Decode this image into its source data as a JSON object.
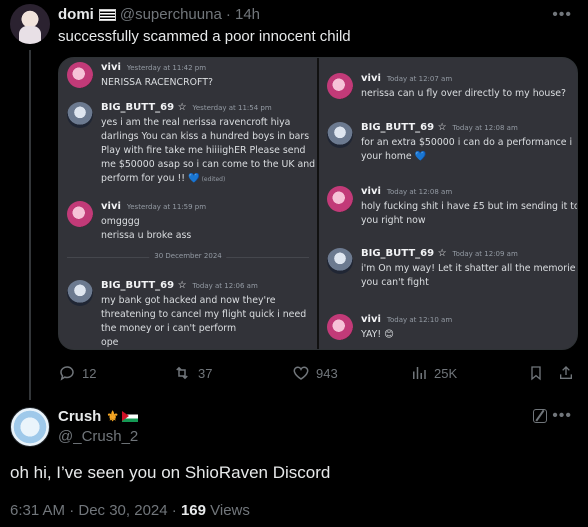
{
  "tweet": {
    "author_name": "domi",
    "handle": "@superchuuna",
    "time": "· 14h",
    "text": "successfully scammed a poor innocent child",
    "screenshot": {
      "left_messages": [
        {
          "author": "vivi",
          "time": "Yesterday at 11:42 pm",
          "lines": [
            "NERISSA RACENCROFT?"
          ],
          "avatar": "vivi"
        },
        {
          "author": "BIG_BUTT_69 ☆",
          "time": "Yesterday at 11:54 pm",
          "lines": [
            "yes i am the real nerissa ravencroft hiya",
            "darlings You can kiss a hundred boys in bars",
            "Play with fire take me hiiiighER Please send",
            "me $50000 asap so i can come to the UK and",
            "perform for you !! 💙"
          ],
          "edited": "(edited)",
          "avatar": "big"
        },
        {
          "author": "vivi",
          "time": "Yesterday at 11:59 pm",
          "lines": [
            "omgggg",
            "nerissa u broke ass"
          ],
          "avatar": "vivi"
        },
        {
          "author": "BIG_BUTT_69 ☆",
          "time": "Today at 12:06 am",
          "lines": [
            "my bank got hacked and now they're",
            "threatening to cancel my flight quick i need",
            "the money or i can't perform",
            "ope"
          ],
          "avatar": "big"
        }
      ],
      "date_separator": "30 December 2024",
      "right_messages": [
        {
          "author": "vivi",
          "time": "Today at 12:07 am",
          "lines": [
            "nerissa can u fly over directly to my house?"
          ],
          "avatar": "vivi"
        },
        {
          "author": "BIG_BUTT_69 ☆",
          "time": "Today at 12:08 am",
          "lines": [
            "for an extra $50000 i can do a performance i",
            "your home 💙"
          ],
          "avatar": "big"
        },
        {
          "author": "vivi",
          "time": "Today at 12:08 am",
          "lines": [
            "holy fucking shit i have £5 but im sending it to",
            "you right now"
          ],
          "avatar": "vivi"
        },
        {
          "author": "BIG_BUTT_69 ☆",
          "time": "Today at 12:09 am",
          "lines": [
            "i'm On my way! Let it shatter all the memorie",
            "you can't fight"
          ],
          "avatar": "big"
        },
        {
          "author": "vivi",
          "time": "Today at 12:10 am",
          "lines": [
            "YAY! 😊"
          ],
          "avatar": "vivi"
        }
      ]
    },
    "actions": {
      "replies": "12",
      "reposts": "37",
      "likes": "943",
      "views": "25K"
    }
  },
  "reply": {
    "author_name": "Crush",
    "handle": "@_Crush_2",
    "text": "oh hi, I’ve seen you on ShioRaven Discord",
    "timestamp": "6:31 AM · Dec 30, 2024 · ",
    "views_count": "169",
    "views_label": " Views"
  }
}
